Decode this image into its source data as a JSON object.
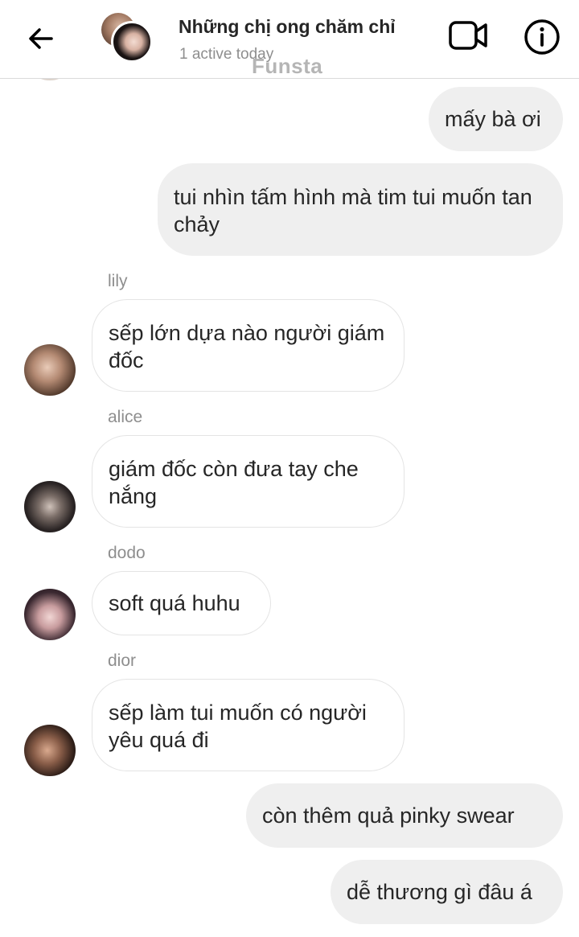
{
  "header": {
    "back_icon": "arrow-left-icon",
    "title": "Những chị ong chăm chỉ",
    "subtitle": "1 active today",
    "watermark": "Funsta",
    "video_icon": "video-camera-icon",
    "info_icon": "info-icon"
  },
  "messages": [
    {
      "direction": "outgoing",
      "text": "mấy bà ơi"
    },
    {
      "direction": "outgoing",
      "text": "tui nhìn tấm hình mà tim tui muốn tan chảy"
    },
    {
      "direction": "incoming",
      "sender": "lily",
      "text": "sếp lớn dựa nào người giám đốc"
    },
    {
      "direction": "incoming",
      "sender": "alice",
      "text": "giám đốc còn đưa tay che nắng"
    },
    {
      "direction": "incoming",
      "sender": "dodo",
      "text": "soft quá huhu"
    },
    {
      "direction": "incoming",
      "sender": "dior",
      "text": "sếp làm tui muốn có người yêu quá đi"
    },
    {
      "direction": "outgoing",
      "text": "còn thêm quả pinky swear"
    },
    {
      "direction": "outgoing",
      "text": "dễ thương gì đâu á"
    }
  ],
  "colors": {
    "outgoing_bubble": "#efefef",
    "incoming_border": "#e4e4e4",
    "secondary_text": "#8e8e8e",
    "primary_text": "#262626"
  }
}
